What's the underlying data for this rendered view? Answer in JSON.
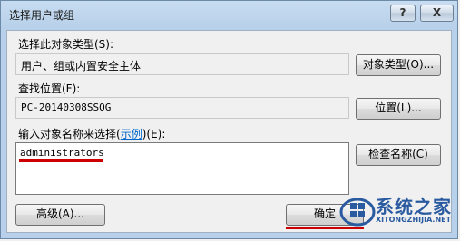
{
  "window": {
    "title": "选择用户或组",
    "help_label": "?",
    "close_label": "X"
  },
  "object_type": {
    "label": "选择此对象类型(S):",
    "value": "用户、组或内置安全主体",
    "button_label": "对象类型(O)..."
  },
  "location": {
    "label": "查找位置(F):",
    "value": "PC-20140308SSOG",
    "button_label": "位置(L)..."
  },
  "object_names": {
    "label_prefix": "输入对象名称来选择(",
    "example_link": "示例",
    "label_suffix": ")(E):",
    "value": "administrators",
    "check_button_label": "检查名称(C)"
  },
  "footer": {
    "advanced_label": "高级(A)...",
    "ok_label": "确定"
  },
  "watermark": {
    "text": "系统之家",
    "url": "XITONGZHIJIA.NET"
  },
  "colors": {
    "annotation_red": "#cc0000",
    "link_blue": "#0066cc"
  }
}
